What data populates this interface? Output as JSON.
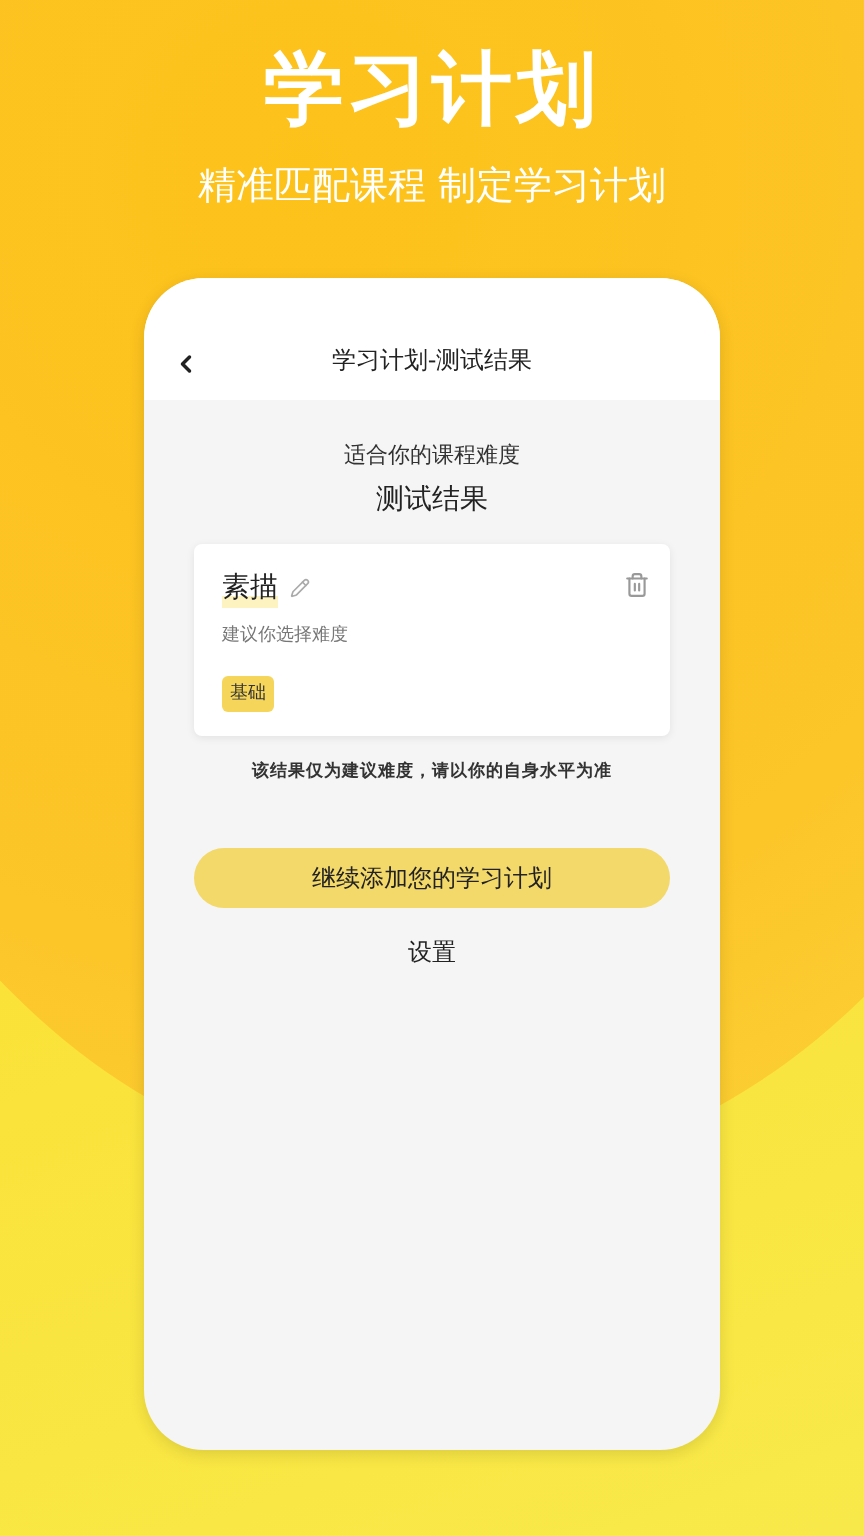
{
  "banner": {
    "title": "学习计划",
    "subtitle": "精准匹配课程 制定学习计划"
  },
  "screen": {
    "title": "学习计划-测试结果",
    "caption": "适合你的课程难度",
    "heading": "测试结果",
    "card": {
      "name": "素描",
      "hint": "建议你选择难度",
      "tag": "基础"
    },
    "note": "该结果仅为建议难度，请以你的自身水平为准",
    "primary_button": "继续添加您的学习计划",
    "link": "设置"
  }
}
